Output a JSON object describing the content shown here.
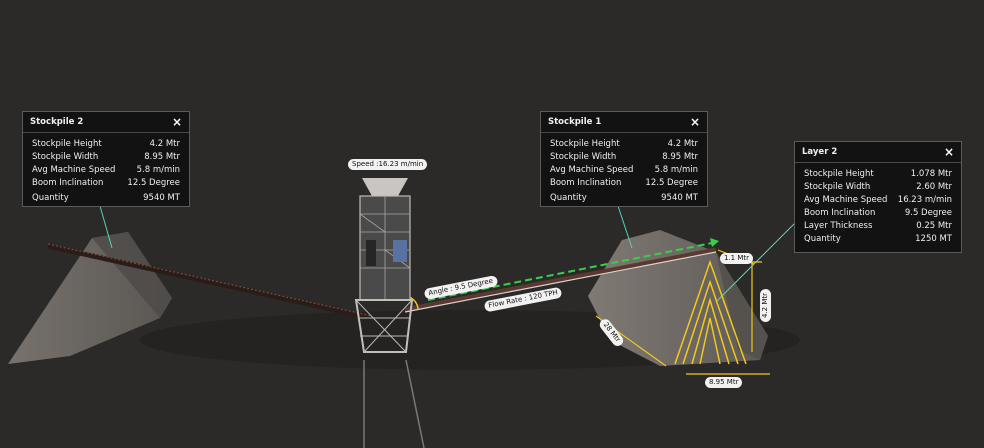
{
  "panels": {
    "stockpile2": {
      "title": "Stockpile 2",
      "rows": [
        {
          "label": "Stockpile Height",
          "value": "4.2 Mtr"
        },
        {
          "label": "Stockpile Width",
          "value": "8.95 Mtr"
        },
        {
          "label": "Avg Machine Speed",
          "value": "5.8  m/min"
        },
        {
          "label": "Boom Inclination",
          "value": "12.5 Degree"
        },
        {
          "label": "Quantity",
          "value": "9540 MT"
        }
      ]
    },
    "stockpile1": {
      "title": "Stockpile 1",
      "rows": [
        {
          "label": "Stockpile Height",
          "value": "4.2 Mtr"
        },
        {
          "label": "Stockpile Width",
          "value": "8.95 Mtr"
        },
        {
          "label": "Avg Machine Speed",
          "value": "5.8  m/min"
        },
        {
          "label": "Boom Inclination",
          "value": "12.5 Degree"
        },
        {
          "label": "Quantity",
          "value": "9540 MT"
        }
      ]
    },
    "layer2": {
      "title": "Layer 2",
      "rows": [
        {
          "label": "Stockpile Height",
          "value": "1.078 Mtr"
        },
        {
          "label": "Stockpile Width",
          "value": "2.60 Mtr"
        },
        {
          "label": "Avg Machine Speed",
          "value": "16.23  m/min"
        },
        {
          "label": "Boom Inclination",
          "value": "9.5 Degree"
        },
        {
          "label": "Layer Thickness",
          "value": "0.25 Mtr"
        },
        {
          "label": "Quantity",
          "value": "1250 MT"
        }
      ]
    }
  },
  "labels": {
    "speed": "Speed :16.23 m/min",
    "angle": "Angle : 9.5 Degree",
    "flow_rate": "Flow Rate : 120 TPH",
    "length_right": "1.1 Mtr",
    "height": "4.2 Mtr",
    "length_side": "28 Mtr",
    "width": "8.95 Mtr"
  },
  "close_icon": "×",
  "colors": {
    "background": "#2b2a29",
    "callout_line": "#4fd6b4",
    "flow_arrow": "#34d24b",
    "dimension": "#f2c81c"
  }
}
